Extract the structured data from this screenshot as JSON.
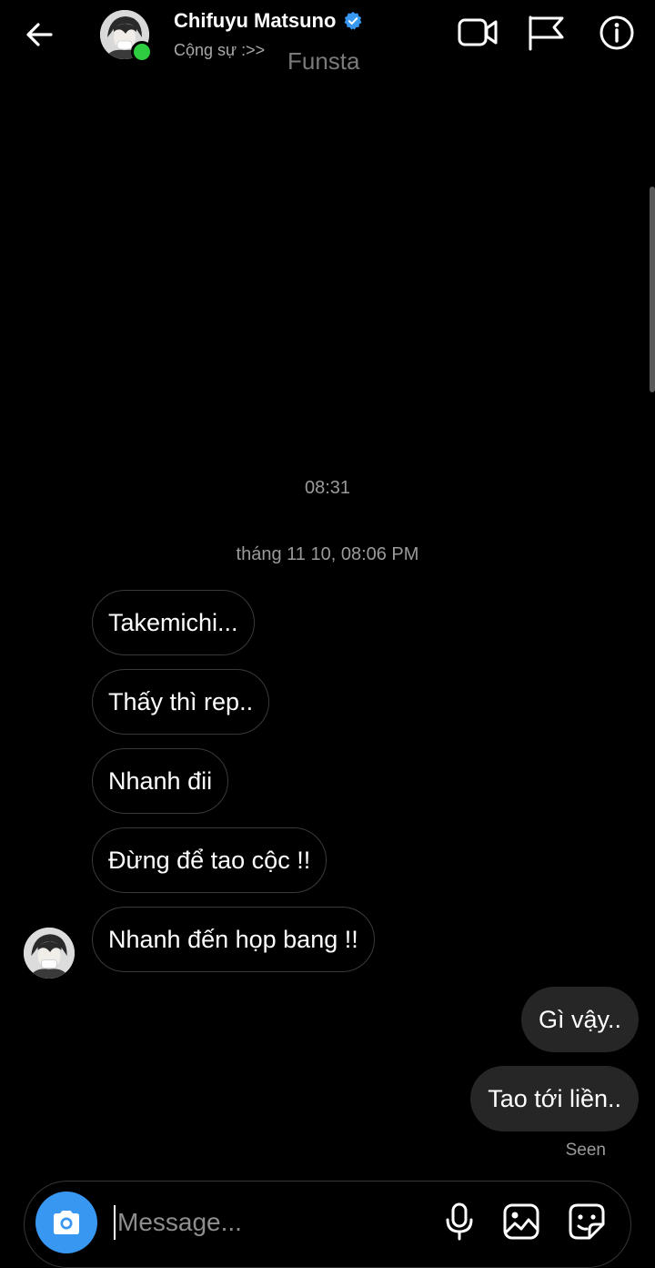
{
  "header": {
    "name": "Chifuyu Matsuno",
    "subtitle": "Cộng sự :>>",
    "watermark": "Funsta"
  },
  "chat": {
    "time_top": "08:31",
    "date_header": "tháng 11 10, 08:06 PM",
    "incoming": [
      "Takemichi...",
      "Thấy thì rep..",
      "Nhanh đii",
      "Đừng để tao cộc !!",
      "Nhanh đến họp bang !!"
    ],
    "outgoing": [
      "Gì vậy..",
      "Tao tới liền.."
    ],
    "seen": "Seen"
  },
  "composer": {
    "placeholder": "Message..."
  },
  "colors": {
    "background": "#000000",
    "accent": "#3897f0",
    "online": "#2ecc40",
    "outgoing_bubble": "#262626",
    "verified": "#3897f0"
  },
  "icons": [
    "back-arrow-icon",
    "verified-badge-icon",
    "video-call-icon",
    "flag-icon",
    "info-icon",
    "camera-icon",
    "microphone-icon",
    "gallery-icon",
    "sticker-icon"
  ]
}
